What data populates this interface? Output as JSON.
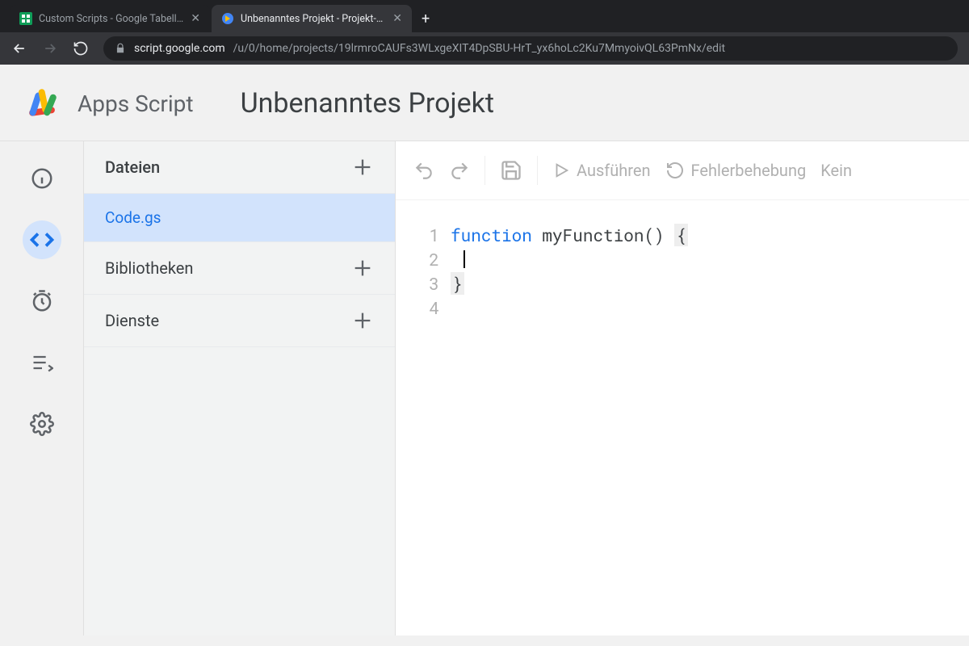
{
  "browser": {
    "tabs": [
      {
        "title": "Custom Scripts - Google Tabellen",
        "favicon": "sheets"
      },
      {
        "title": "Unbenanntes Projekt - Projekt-Editor",
        "favicon": "apps-script"
      }
    ],
    "url_host": "script.google.com",
    "url_path": "/u/0/home/projects/19lrmroCAUFs3WLxgeXIT4DpSBU-HrT_yx6hoLc2Ku7MmyoivQL63PmNx/edit"
  },
  "header": {
    "brand": "Apps Script",
    "project_title": "Unbenanntes Projekt"
  },
  "files_panel": {
    "sections": {
      "files": "Dateien",
      "libraries": "Bibliotheken",
      "services": "Dienste"
    },
    "files": [
      {
        "name": "Code.gs",
        "active": true
      }
    ]
  },
  "toolbar": {
    "run": "Ausführen",
    "debug": "Fehlerbehebung",
    "func_select": "Kein"
  },
  "editor": {
    "lines": [
      "1",
      "2",
      "3",
      "4"
    ],
    "keyword": "function",
    "sig": " myFunction() ",
    "open_brace": "{",
    "close_brace": "}"
  }
}
